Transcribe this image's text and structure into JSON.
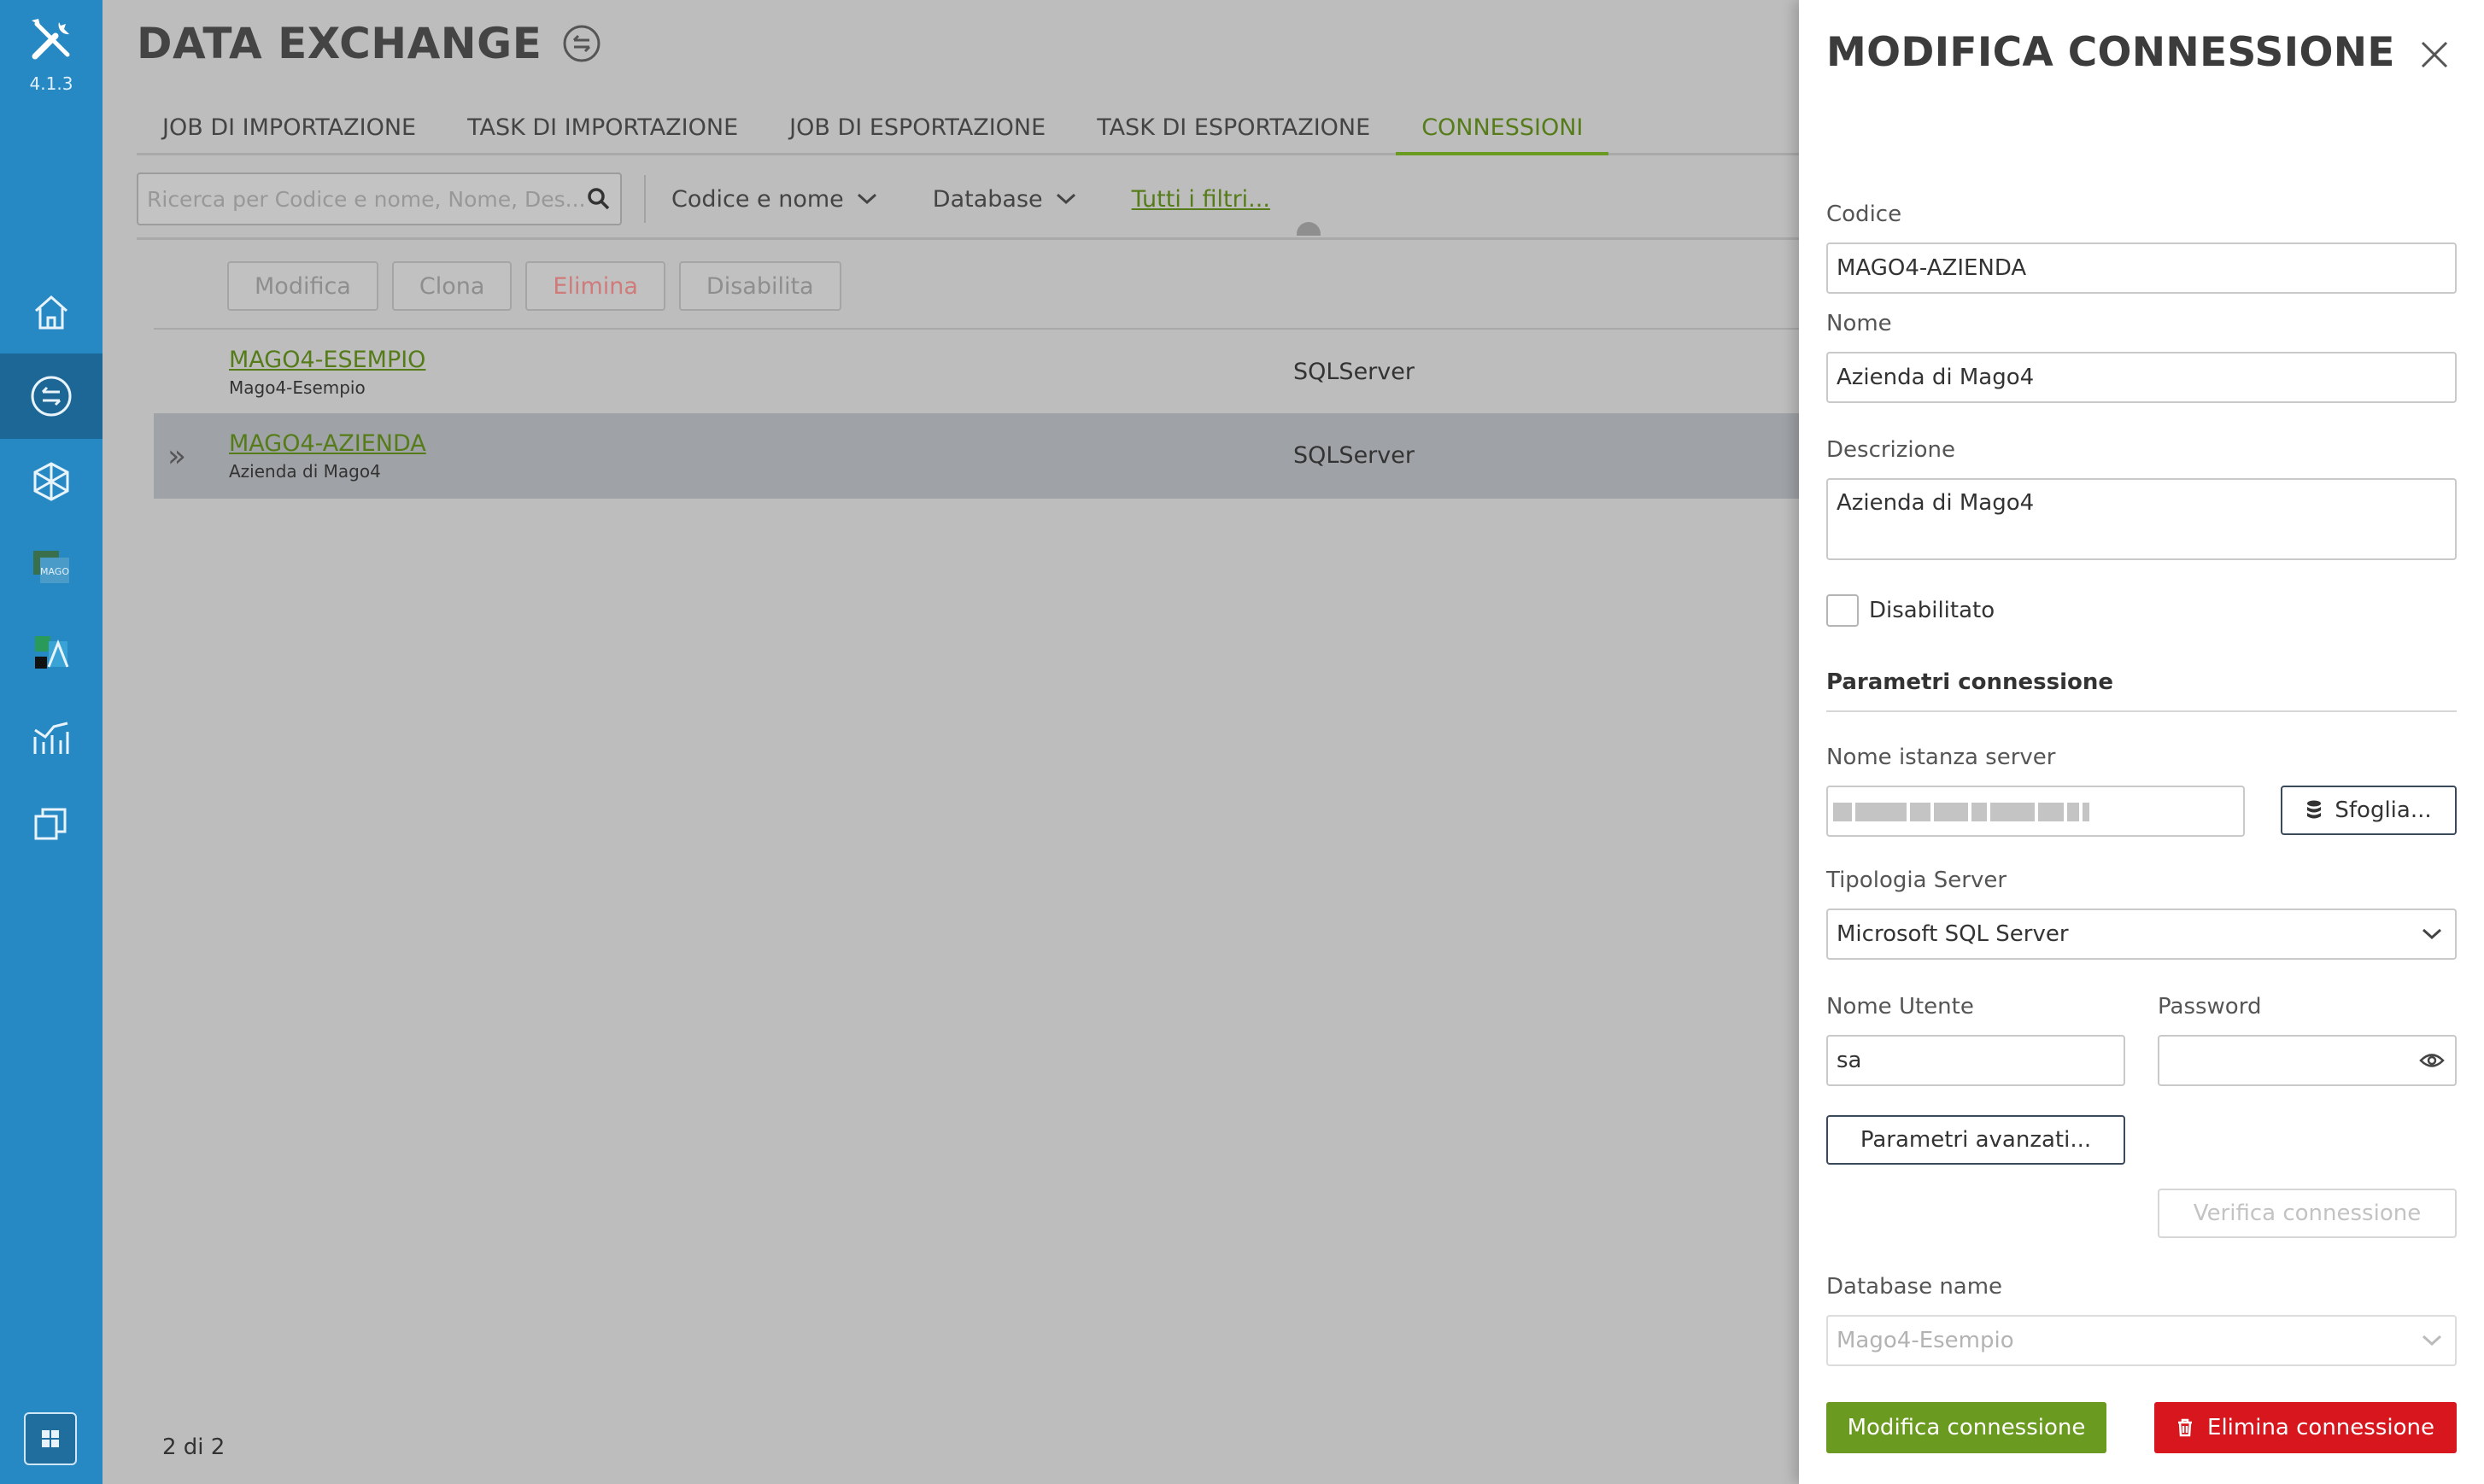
{
  "app": {
    "version": "4.1.3"
  },
  "nav": {
    "items": [
      {
        "icon": "home-icon"
      },
      {
        "icon": "data-exchange-icon",
        "active": true
      },
      {
        "icon": "cube-network-icon"
      },
      {
        "icon": "mago-cloud-icon"
      },
      {
        "icon": "analytics-app-icon"
      },
      {
        "icon": "chart-icon"
      },
      {
        "icon": "copy-windows-icon"
      }
    ],
    "bottom_icon": "grid-icon"
  },
  "page": {
    "title": "DATA EXCHANGE"
  },
  "tabs": [
    {
      "label": "JOB DI IMPORTAZIONE"
    },
    {
      "label": "TASK DI IMPORTAZIONE"
    },
    {
      "label": "JOB DI ESPORTAZIONE"
    },
    {
      "label": "TASK DI ESPORTAZIONE"
    },
    {
      "label": "CONNESSIONI",
      "active": true
    }
  ],
  "toolbar": {
    "search_placeholder": "Ricerca per Codice e nome, Nome, Des...",
    "filter_code": "Codice e nome",
    "filter_db": "Database",
    "all_filters": "Tutti i filtri..."
  },
  "actions": {
    "edit": "Modifica",
    "clone": "Clona",
    "delete": "Elimina",
    "disable": "Disabilita"
  },
  "connections": [
    {
      "code": "MAGO4-ESEMPIO",
      "name": "Mago4-Esempio",
      "db": "SQLServer"
    },
    {
      "code": "MAGO4-AZIENDA",
      "name": "Azienda di Mago4",
      "db": "SQLServer",
      "selected": true
    }
  ],
  "footer": {
    "count": "2 di 2"
  },
  "panel": {
    "title": "MODIFICA CONNESSIONE",
    "code_label": "Codice",
    "code_value": "MAGO4-AZIENDA",
    "name_label": "Nome",
    "name_value": "Azienda di Mago4",
    "desc_label": "Descrizione",
    "desc_value": "Azienda di Mago4",
    "disabled_label": "Disabilitato",
    "section_title": "Parametri connessione",
    "server_label": "Nome istanza server",
    "browse_label": "Sfoglia...",
    "server_type_label": "Tipologia Server",
    "server_type_value": "Microsoft SQL Server",
    "user_label": "Nome Utente",
    "user_value": "sa",
    "password_label": "Password",
    "advanced_label": "Parametri avanzati...",
    "verify_label": "Verifica connessione",
    "dbname_label": "Database name",
    "dbname_value": "Mago4-Esempio",
    "save_label": "Modifica connessione",
    "delete_label": "Elimina connessione"
  },
  "colors": {
    "nav_blue": "#2789c3",
    "accent_green": "#6a9a1f",
    "danger_red": "#d8161e"
  }
}
